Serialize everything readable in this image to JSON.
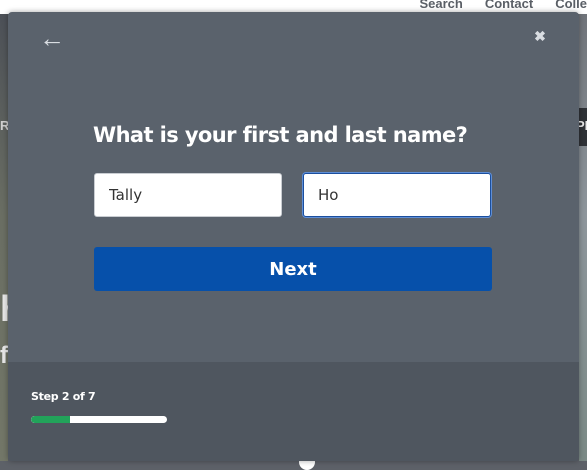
{
  "background": {
    "nav_links": [
      "Search",
      "Contact",
      "Colle"
    ],
    "left_fragments": [
      "R",
      "h",
      "f"
    ],
    "right_fragment": "PL"
  },
  "modal": {
    "back_icon": "arrow-left-icon",
    "close_icon": "close-icon",
    "question": "What is your first and last name?",
    "first_name": {
      "value": "Tally",
      "placeholder": ""
    },
    "last_name": {
      "value": "Ho",
      "placeholder": ""
    },
    "next_label": "Next",
    "step_text": "Step 2 of 7",
    "progress": {
      "current_step": 2,
      "total_steps": 7,
      "fraction": 0.2857
    }
  },
  "colors": {
    "modal_bg": "#5a626c",
    "footer_bg": "#4f565f",
    "button": "#0650aa",
    "progress_fill": "#22a35a"
  }
}
